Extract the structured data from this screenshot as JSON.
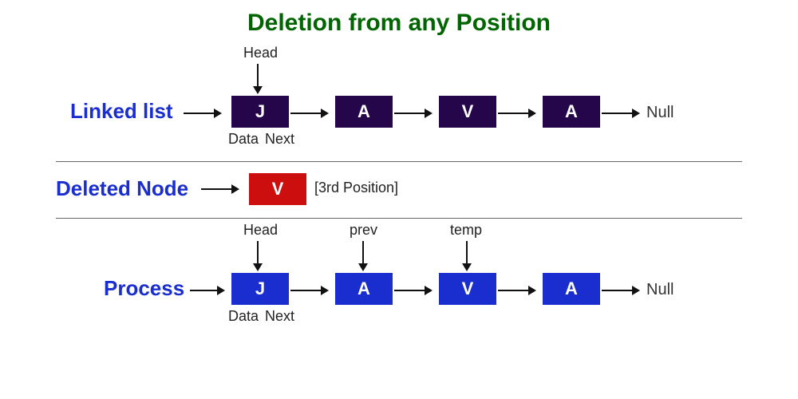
{
  "title": "Deletion from any Position",
  "row1": {
    "label": "Linked list",
    "head": "Head",
    "data_label": "Data",
    "next_label": "Next",
    "nodes": [
      "J",
      "A",
      "V",
      "A"
    ],
    "end": "Null"
  },
  "row2": {
    "label": "Deleted Node",
    "node": "V",
    "note": "[3rd Position]"
  },
  "row3": {
    "label": "Process",
    "head": "Head",
    "prev": "prev",
    "temp": "temp",
    "data_label": "Data",
    "next_label": "Next",
    "nodes": [
      "J",
      "A",
      "V",
      "A"
    ],
    "end": "Null"
  },
  "colors": {
    "purple": "#26064a",
    "blue": "#1a2ed0",
    "red": "#cc0e0e",
    "green": "#006400"
  }
}
